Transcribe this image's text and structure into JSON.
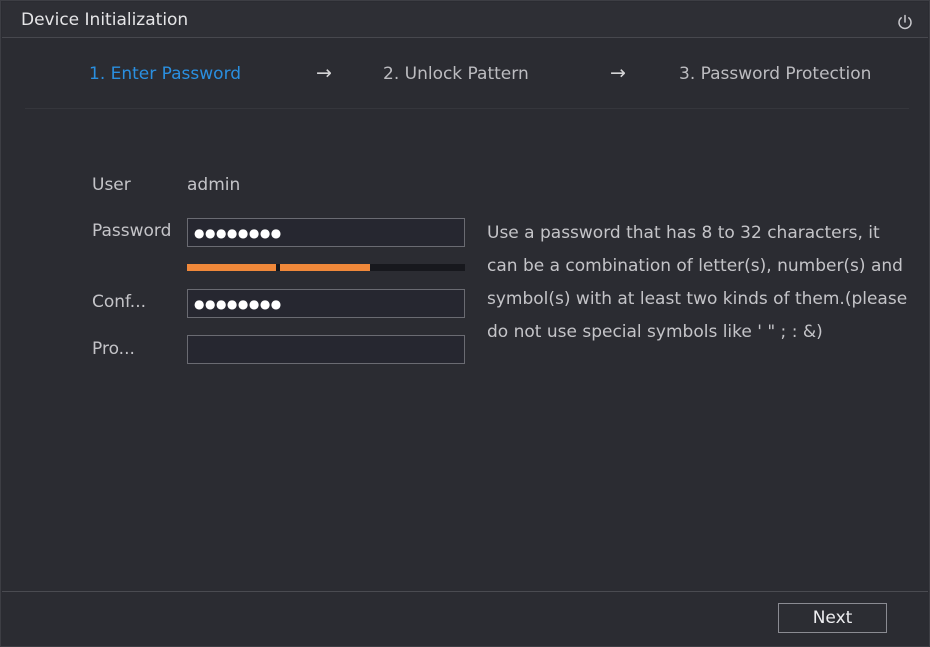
{
  "window": {
    "title": "Device Initialization",
    "power_icon": "power-icon"
  },
  "steps": [
    {
      "label": "1.  Enter Password",
      "active": true
    },
    {
      "label": "2.  Unlock Pattern",
      "active": false
    },
    {
      "label": "3.  Password Protection",
      "active": false
    }
  ],
  "step_arrow": "→",
  "form": {
    "user_label": "User",
    "user_value": "admin",
    "password_label": "Password",
    "password_value": "●●●●●●●●",
    "password_strength": "2 of 3 segments",
    "confirm_label": "Conf...",
    "confirm_value": "●●●●●●●●",
    "prompt_label": "Pro...",
    "prompt_value": ""
  },
  "hint": "Use a password that has 8 to 32 characters, it\ncan be a combination of letter(s), number(s) and\nsymbol(s) with at least two kinds of them.(please\n do not use special symbols like ' \" ; : &)",
  "footer": {
    "next_label": "Next"
  },
  "colors": {
    "accent": "#2a8fe0",
    "strength": "#f0883a",
    "background": "#2b2c32"
  }
}
